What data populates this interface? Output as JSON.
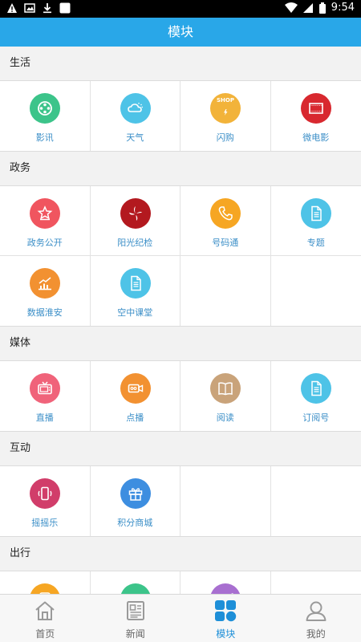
{
  "status": {
    "time": "9:54"
  },
  "header": {
    "title": "模块"
  },
  "sections": [
    {
      "title": "生活",
      "items": [
        {
          "label": "影讯",
          "icon": "film-reel-icon",
          "color": "#3cc48a"
        },
        {
          "label": "天气",
          "icon": "weather-icon",
          "color": "#4ec3e7"
        },
        {
          "label": "闪购",
          "icon": "shop-icon",
          "color": "#f2b33a",
          "badge": "SHOP"
        },
        {
          "label": "微电影",
          "icon": "micro-film-icon",
          "color": "#d8282f"
        }
      ]
    },
    {
      "title": "政务",
      "items": [
        {
          "label": "政务公开",
          "icon": "star-badge-icon",
          "color": "#f0555f"
        },
        {
          "label": "阳光纪检",
          "icon": "sunshine-logo-icon",
          "color": "#b3191f"
        },
        {
          "label": "号码通",
          "icon": "phone-icon",
          "color": "#f6a623"
        },
        {
          "label": "专题",
          "icon": "document-icon",
          "color": "#4ec3e7"
        },
        {
          "label": "数据淮安",
          "icon": "chart-icon",
          "color": "#f29131"
        },
        {
          "label": "空中课堂",
          "icon": "document-icon",
          "color": "#4ec3e7"
        }
      ]
    },
    {
      "title": "媒体",
      "items": [
        {
          "label": "直播",
          "icon": "tv-icon",
          "color": "#f0637a"
        },
        {
          "label": "点播",
          "icon": "camera-icon",
          "color": "#f29131"
        },
        {
          "label": "阅读",
          "icon": "book-icon",
          "color": "#c9a37a"
        },
        {
          "label": "订阅号",
          "icon": "document-icon",
          "color": "#4ec3e7"
        }
      ]
    },
    {
      "title": "互动",
      "items": [
        {
          "label": "摇摇乐",
          "icon": "shake-phone-icon",
          "color": "#d13d6a"
        },
        {
          "label": "积分商城",
          "icon": "gift-icon",
          "color": "#3d8ee0"
        }
      ]
    },
    {
      "title": "出行",
      "items": [
        {
          "label": "",
          "icon": "bus-icon",
          "color": "#f6a623"
        },
        {
          "label": "",
          "icon": "car-icon",
          "color": "#3cc48a"
        },
        {
          "label": "",
          "icon": "plane-icon",
          "color": "#a86fd0"
        }
      ]
    }
  ],
  "tabs": [
    {
      "label": "首页",
      "icon": "home-icon",
      "active": false
    },
    {
      "label": "新闻",
      "icon": "newspaper-icon",
      "active": false
    },
    {
      "label": "模块",
      "icon": "modules-icon",
      "active": true
    },
    {
      "label": "我的",
      "icon": "profile-icon",
      "active": false
    }
  ]
}
